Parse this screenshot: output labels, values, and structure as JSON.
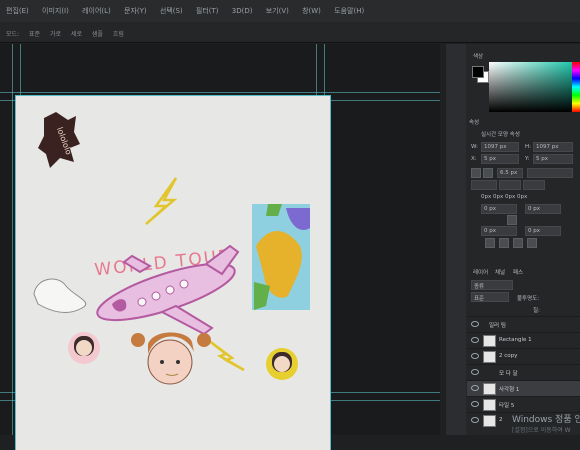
{
  "menu": {
    "items": [
      "편집(E)",
      "이미지(I)",
      "레이어(L)",
      "문자(Y)",
      "선택(S)",
      "필터(T)",
      "3D(D)",
      "보기(V)",
      "창(W)",
      "도움말(H)"
    ]
  },
  "options": {
    "items": [
      "모드:",
      "표준",
      "가로",
      "세로",
      "샘플",
      "흐림"
    ]
  },
  "artwork": {
    "title": "WORLD TOUR",
    "sticker_text": "lolololo"
  },
  "color_panel": {
    "label": "색상",
    "accent": "#14c4a6"
  },
  "properties": {
    "title": "속성",
    "subtitle": "실시간 모양 속성",
    "w_label": "W:",
    "w_value": "1097 px",
    "h_label": "H:",
    "h_value": "1097 px",
    "x_label": "X:",
    "x_value": "5 px",
    "y_label": "Y:",
    "y_value": "5 px",
    "stroke_value": "6.5 px",
    "corner_label": "0px 0px 0px 0px",
    "corner_fields": [
      "0 px",
      "0 px",
      "0 px",
      "0 px"
    ]
  },
  "layers": {
    "tabs": [
      "레이어",
      "채널",
      "패스"
    ],
    "filter_label": "종류",
    "blend_mode": "표준",
    "opacity_label": "불투명도:",
    "fill_label": "칠:",
    "items": [
      {
        "name": "일러 팀",
        "kind": "group"
      },
      {
        "name": "Rectangle 1",
        "kind": "shape"
      },
      {
        "name": "2 copy",
        "kind": "image"
      },
      {
        "name": "모 다 달",
        "kind": "text"
      },
      {
        "name": "사각형 1",
        "kind": "shape"
      },
      {
        "name": "타일 5",
        "kind": "image"
      },
      {
        "name": "2",
        "kind": "image"
      }
    ]
  },
  "watermark": {
    "line1": "Windows 정품 인",
    "line2": "[설정]으로 이동하여 W"
  }
}
